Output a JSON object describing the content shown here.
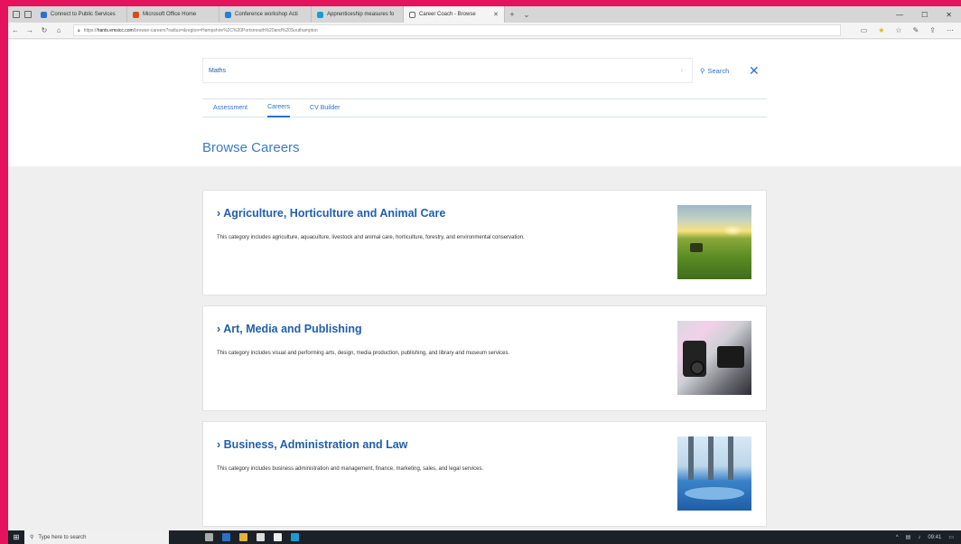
{
  "browser": {
    "tabs": [
      {
        "label": "Connect to Public Services",
        "favicon_color": "#2a6fd1",
        "active": false
      },
      {
        "label": "Microsoft Office Home",
        "favicon_color": "#d84a1b",
        "active": false
      },
      {
        "label": "Conference workshop Acti",
        "favicon_color": "#2b7cd3",
        "active": false
      },
      {
        "label": "Apprenticeship measures fo",
        "favicon_color": "#1d9bd1",
        "active": false
      },
      {
        "label": "Career Coach - Browse",
        "favicon_color": "#666666",
        "active": true
      }
    ],
    "new_tab_symbol": "+",
    "url_prefix": "https://",
    "url_domain": "hants.emsicc.com",
    "url_path": "/browse-careers?radius=&region=Hampshire%2C%20Portsmouth%20and%20Southampton"
  },
  "search": {
    "value": "Maths",
    "button_label": "Search",
    "close_symbol": "✕"
  },
  "nav_tabs": [
    {
      "label": "Assessment",
      "selected": false
    },
    {
      "label": "Careers",
      "selected": true
    },
    {
      "label": "CV Builder",
      "selected": false
    }
  ],
  "page_title": "Browse Careers",
  "careers": [
    {
      "title": "Agriculture, Horticulture and Animal Care",
      "description": "This category includes agriculture, aquaculture, livestock and animal care, horticulture, forestry, and environmental conservation.",
      "image": "tractor-field-sunset"
    },
    {
      "title": "Art, Media and Publishing",
      "description": "This category includes visual and performing arts, design, media production, publishing, and library and museum services.",
      "image": "film-cameras"
    },
    {
      "title": "Business, Administration and Law",
      "description": "This category includes business administration and management, finance, marketing, sales, and legal services.",
      "image": "boardroom-table"
    }
  ],
  "taskbar": {
    "search_placeholder": "Type here to search",
    "time": "09:41"
  },
  "colors": {
    "frame": "#e5135c",
    "accent": "#2a72c8",
    "card_title": "#1f5fae"
  }
}
